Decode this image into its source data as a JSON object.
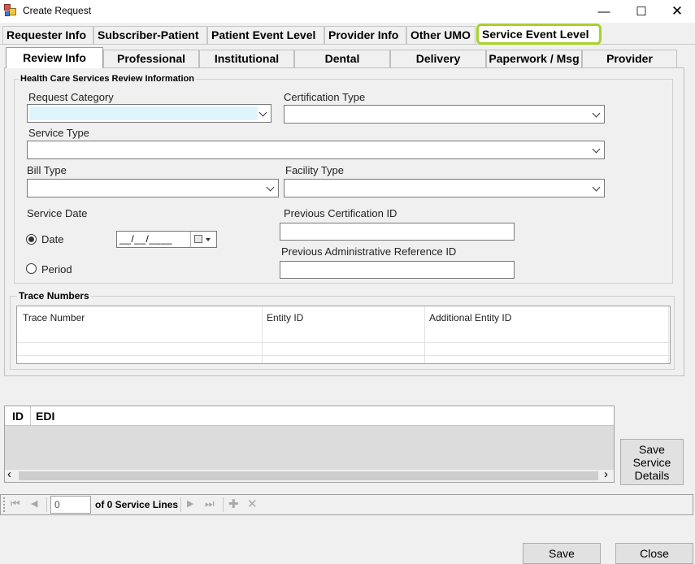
{
  "window": {
    "title": "Create Request",
    "minimize_glyph": "—",
    "maximize_glyph": "☐",
    "close_glyph": "✕"
  },
  "top_tabs": [
    {
      "label": "Requester Info"
    },
    {
      "label": "Subscriber-Patient"
    },
    {
      "label": "Patient Event Level"
    },
    {
      "label": "Provider Info"
    },
    {
      "label": "Other UMO"
    },
    {
      "label": "Service Event Level",
      "active": true
    }
  ],
  "sub_tabs": [
    {
      "label": "Review Info",
      "active": true
    },
    {
      "label": "Professional"
    },
    {
      "label": "Institutional"
    },
    {
      "label": "Dental"
    },
    {
      "label": "Delivery"
    },
    {
      "label": "Paperwork / Msg"
    },
    {
      "label": "Provider"
    }
  ],
  "review_group": {
    "title": "Health Care Services Review Information",
    "request_category": {
      "label": "Request Category",
      "value": ""
    },
    "certification_type": {
      "label": "Certification Type",
      "value": ""
    },
    "service_type": {
      "label": "Service Type",
      "value": ""
    },
    "bill_type": {
      "label": "Bill Type",
      "value": ""
    },
    "facility_type": {
      "label": "Facility Type",
      "value": ""
    },
    "service_date": {
      "label": "Service Date",
      "date_option": "Date",
      "period_option": "Period",
      "selected": "Date",
      "date_value": "__/__/____"
    },
    "previous_certification_id": {
      "label": "Previous Certification ID",
      "value": ""
    },
    "previous_admin_ref_id": {
      "label": "Previous Administrative Reference ID",
      "value": ""
    }
  },
  "trace_group": {
    "title": "Trace Numbers",
    "columns": [
      "Trace Number",
      "Entity ID",
      "Additional Entity ID"
    ]
  },
  "service_lines_grid": {
    "columns": [
      "ID",
      "EDI"
    ],
    "scroll_left": "‹",
    "scroll_right": "›"
  },
  "save_service_details_button": "Save Service Details",
  "navigator": {
    "position": "0",
    "count_text": "of 0 Service Lines",
    "first_glyph": "⏮",
    "prev_glyph": "◀",
    "next_glyph": "▶",
    "last_glyph": "⏭",
    "add_glyph": "✚",
    "delete_glyph": "✕"
  },
  "footer": {
    "save_label": "Save",
    "close_label": "Close"
  }
}
